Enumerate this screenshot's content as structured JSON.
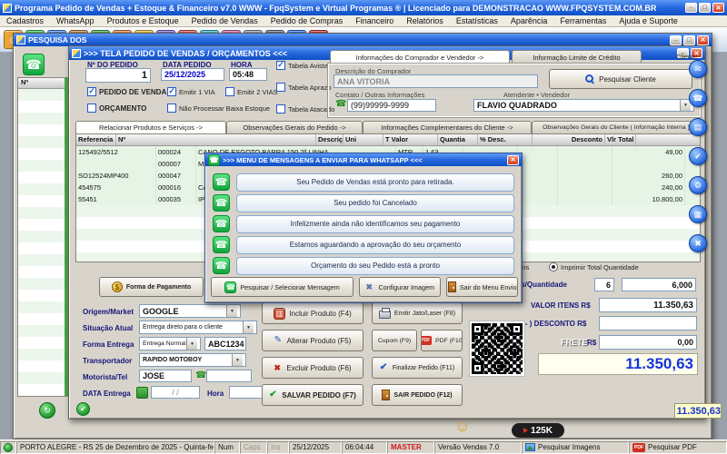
{
  "app": {
    "title": "Programa Pedido de Vendas + Estoque & Financeiro v7.0 WWW - FpqSystem e Virtual Programas ® | Licenciado para DEMONSTRACAO WWW.FPQSYSTEM.COM.BR"
  },
  "menu": {
    "items": [
      "Cadastros",
      "WhatsApp",
      "Produtos e Estoque",
      "Pedido de Vendas",
      "Pedido de Compras",
      "Financeiro",
      "Relatórios",
      "Estatísticas",
      "Aparência",
      "Ferramentas",
      "Ajuda e Suporte"
    ]
  },
  "toolbar": {
    "icons": [
      {
        "n": "clientes-icon",
        "g": "☺",
        "c": "#e9a63a"
      },
      {
        "n": "whatsapp-icon",
        "g": "☎",
        "c": "#34c24d"
      },
      {
        "n": "produtos-icon",
        "g": "▦",
        "c": "#3d7fe0"
      },
      {
        "n": "estoque-icon",
        "g": "▤",
        "c": "#b07a3a"
      },
      {
        "n": "pedido-venda-icon",
        "g": "$",
        "c": "#3aa63a"
      },
      {
        "n": "pedido-compra-icon",
        "g": "▥",
        "c": "#e07a2a"
      },
      {
        "n": "financeiro-icon",
        "g": "$",
        "c": "#e0b82a"
      },
      {
        "n": "relatorios-icon",
        "g": "▧",
        "c": "#7a5ad0"
      },
      {
        "n": "estatisticas-icon",
        "g": "▲",
        "c": "#d04a3a"
      },
      {
        "n": "mensagens-icon",
        "g": "✉",
        "c": "#2ab0c0"
      },
      {
        "n": "aparencia-icon",
        "g": "✎",
        "c": "#d05a9a"
      },
      {
        "n": "ferramentas-icon",
        "g": "⚙",
        "c": "#8a8f98"
      },
      {
        "n": "imprimir-icon",
        "g": "▤",
        "c": "#5a6a7a"
      },
      {
        "n": "ajuda-icon",
        "g": "?",
        "c": "#2a6ae0"
      },
      {
        "n": "sair-icon",
        "g": "✖",
        "c": "#c03030"
      }
    ]
  },
  "bg_window": {
    "title": "PESQUISA DOS",
    "list_header": "Nº",
    "partial_total": "11.350,63",
    "side_buttons": [
      {
        "g": "✉"
      },
      {
        "g": "☎"
      },
      {
        "g": "▤"
      },
      {
        "g": "✔"
      },
      {
        "g": "⚙"
      },
      {
        "g": "▦"
      },
      {
        "g": "✖"
      }
    ]
  },
  "order_window": {
    "title": ">>> TELA PEDIDO DE VENDAS / ORÇAMENTOS <<<",
    "cliente": "Cliente",
    "header": {
      "numero_label": "Nº DO PEDIDO",
      "numero": "1",
      "data_label": "DATA PEDIDO",
      "data": "25/12/2025",
      "hora_label": "HORA",
      "hora": "05:48",
      "cb_pedido": "PEDIDO DE VENDA",
      "cb_orcamento": "ORÇAMENTO",
      "cb_via1": "Emitir 1 VIA",
      "cb_via2": "Emitir 2 VIAS",
      "cb_baixa": "Não Processar Baixa Estoque",
      "cb_avista": "Tabela Avista",
      "cb_aprazo": "Tabela Aprazo",
      "cb_atacado": "Tabela Atacado"
    },
    "buyer": {
      "tab_info": "Informações do Comprador e Vendedor ->",
      "tab_credito": "Informação Limite de Crédito",
      "descricao_label": "Descrição do Comprador",
      "descricao": "ANA VITORIA",
      "pesquisar_btn": "Pesquisar Cliente",
      "contato_label": "Contato / Outras Informações",
      "telefone": "(99)99999-9999",
      "atendente_label": "Atendente • Vendedor",
      "atendente": "FLAVIO QUADRADO"
    },
    "tabs": [
      "Relacionar Produtos e Serviços ->",
      "Observações Gerais do Pedido ->",
      "Informações Complementares do Cliente ->",
      "Observações Gerais do Cliente ( Informação Interna )"
    ],
    "table": {
      "columns": [
        "Referencia",
        "Nº",
        "Descrição do Produto",
        "Uni",
        "T Valor",
        "Quantia",
        "% Desc.",
        "Desconto",
        "Vlr Total"
      ],
      "rows": [
        {
          "ref": "125492/5512",
          "num": "000024",
          "desc": "CANO DE ESGOTO BARRA 150 2ª LINHA",
          "uni": "MTR",
          "valor": "1,63",
          "quantia": "",
          "perc": "",
          "desconto": "",
          "total": "49,00"
        },
        {
          "ref": "",
          "num": "000007",
          "desc": "MEMORIA",
          "uni": "",
          "valor": "",
          "quantia": "",
          "perc": "",
          "desconto": "",
          "total": ""
        },
        {
          "ref": "SO12524MP400",
          "num": "000047",
          "desc": "",
          "uni": "",
          "valor": "",
          "quantia": "",
          "perc": "",
          "desconto": "",
          "total": "260,00"
        },
        {
          "ref": "454575",
          "num": "000016",
          "desc": "CADEIRA",
          "uni": "",
          "valor": "",
          "quantia": "",
          "perc": "",
          "desconto": "",
          "total": "240,00"
        },
        {
          "ref": "55451",
          "num": "000035",
          "desc": "IPHONE",
          "uni": "",
          "valor": "",
          "quantia": "",
          "perc": "",
          "desconto": "",
          "total": "10.800,00"
        }
      ]
    },
    "payment_btn": "Forma de Pagamento",
    "radios": {
      "itens": "Imprimir Total Itens",
      "quantidade": "Imprimir Total Quantidade"
    },
    "totals": {
      "itens_label": "Itens/Quantidade",
      "itens": "6",
      "quantia": "6,000",
      "valor_label": "VALOR ITENS R$",
      "valor": "11.350,63",
      "desconto_label": "( - ) DESCONTO R$",
      "desconto": "",
      "frete_label": "FRETE",
      "frete_rs": "R$",
      "frete": "0,00",
      "total": "11.350,63"
    },
    "fields": {
      "origem_label": "Origem/Market",
      "origem": "GOOGLE",
      "situacao_label": "Situação Atual",
      "situacao": "Entrega direto para o cliente",
      "entrega_label": "Forma Entrega",
      "entrega": "Entrega Normal",
      "placa": "ABC1234",
      "transportador_label": "Transportador",
      "transportador": "RAPIDO MOTOBOY",
      "motorista_label": "Motorista/Tel",
      "motorista": "JOSE",
      "motorista_tel": "",
      "data_label": "DATA Entrega",
      "data": "/  /",
      "hora_label": "Hora",
      "hora": ""
    },
    "buttons": {
      "incluir": "Incluir Produto (F4)",
      "alterar": "Alterar Produto (F5)",
      "excluir": "Excluir Produto (F6)",
      "salvar": "SALVAR PEDIDO (F7)",
      "emitir": "Emitir Jato/Laser (F8)",
      "cupom": "Cupom (F9)",
      "pdf": "PDF (F10)",
      "finalizar": "Finalizar Pedido (F11)",
      "sair": "SAIR PEDIDO (F12)"
    }
  },
  "modal": {
    "title": ">>> MENU DE MENSAGENS A ENVIAR PARA WHATSAPP <<<",
    "messages": [
      "Seu Pedido de Vendas está pronto para retirada.",
      "Seu pedido foi Cancelado",
      "Infelizmente ainda não identificamos seu pagamento",
      "Estamos aguardando a aprovação do seu orçamento",
      "Orçamento do seu Pedido está a pronto"
    ],
    "btn_pesquisar": "Pesquisar / Selecionar Mensagem",
    "btn_configurar": "Configurar Imagem",
    "btn_sair": "Sair do Menu Envio"
  },
  "badge": {
    "text": "125K"
  },
  "statusbar": {
    "local": "PORTO ALEGRE - RS 25 de Dezembro de 2025 - Quinta-feira",
    "num": "Num",
    "caps": "Caps",
    "ins": "Ins",
    "data": "25/12/2025",
    "hora": "06:04:44",
    "usuario": "MASTER",
    "versao": "Versão Vendas 7.0",
    "pesquisar_imagens": "Pesquisar Imagens",
    "pesquisar_pdf": "Pesquisar PDF"
  }
}
